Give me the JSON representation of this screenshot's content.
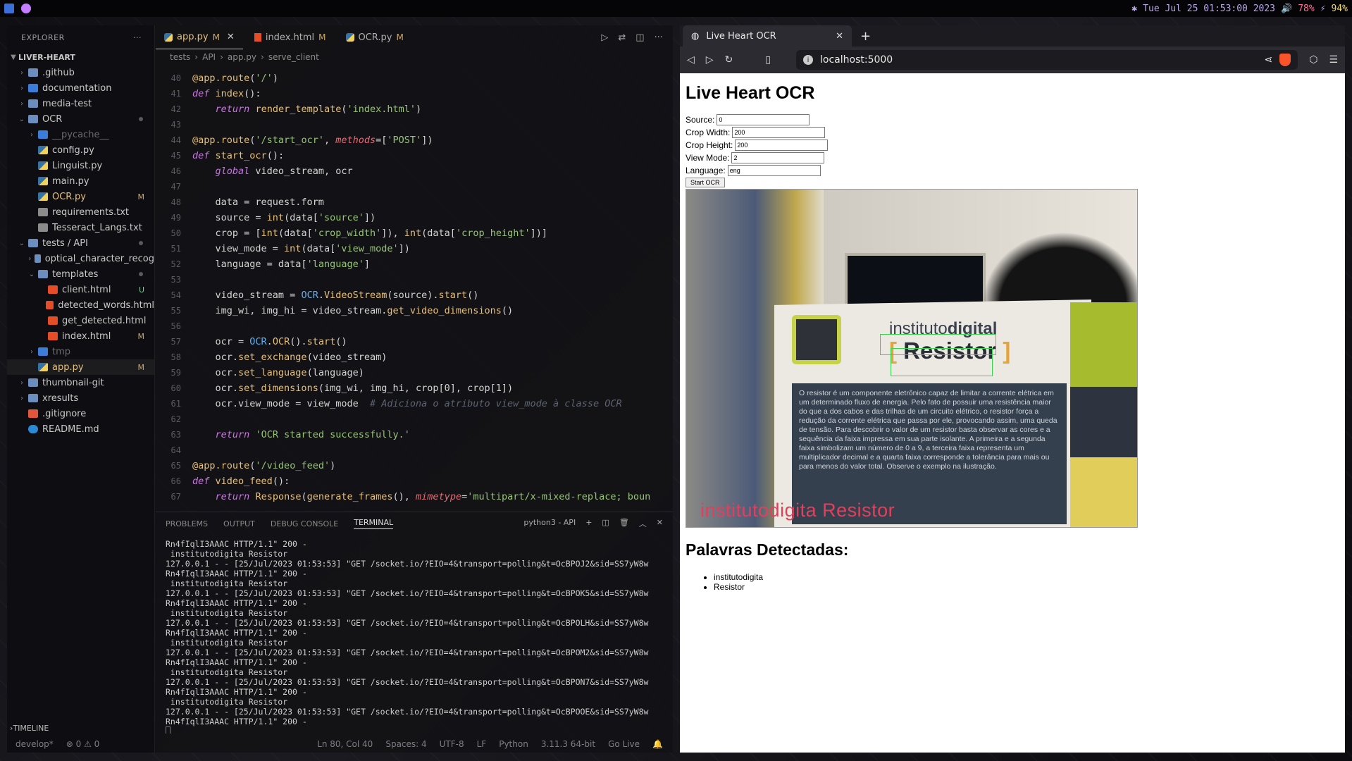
{
  "topbar": {
    "datetime": "Tue Jul 25 01:53:00 2023",
    "volume": "78%",
    "battery": "94%"
  },
  "vscode": {
    "explorer": {
      "title": "EXPLORER",
      "project": "LIVER-HEART",
      "items": [
        {
          "label": ".github",
          "type": "folder"
        },
        {
          "label": "documentation",
          "type": "folder"
        },
        {
          "label": "media-test",
          "type": "folder"
        },
        {
          "label": "OCR",
          "type": "folder"
        },
        {
          "label": "__pycache__",
          "type": "folder"
        },
        {
          "label": "config.py",
          "type": "py"
        },
        {
          "label": "Linguist.py",
          "type": "py"
        },
        {
          "label": "main.py",
          "type": "py"
        },
        {
          "label": "OCR.py",
          "type": "py",
          "badge": "M"
        },
        {
          "label": "requirements.txt",
          "type": "txt"
        },
        {
          "label": "Tesseract_Langs.txt",
          "type": "txt"
        },
        {
          "label": "tests / API",
          "type": "folder"
        },
        {
          "label": "optical_character_recog",
          "type": "folder"
        },
        {
          "label": "templates",
          "type": "folder"
        },
        {
          "label": "client.html",
          "type": "html",
          "badge": "U"
        },
        {
          "label": "detected_words.html",
          "type": "html"
        },
        {
          "label": "get_detected.html",
          "type": "html"
        },
        {
          "label": "index.html",
          "type": "html",
          "badge": "M"
        },
        {
          "label": "tmp",
          "type": "folder"
        },
        {
          "label": "app.py",
          "type": "py",
          "badge": "M"
        },
        {
          "label": "thumbnail-git",
          "type": "folder"
        },
        {
          "label": "xresults",
          "type": "folder"
        },
        {
          "label": ".gitignore",
          "type": "git"
        },
        {
          "label": "README.md",
          "type": "md"
        }
      ],
      "timeline": "TIMELINE"
    },
    "tabs": [
      {
        "label": "app.py",
        "badge": "M"
      },
      {
        "label": "index.html",
        "badge": "M"
      },
      {
        "label": "OCR.py",
        "badge": "M"
      }
    ],
    "breadcrumb": [
      "tests",
      "API",
      "app.py",
      "serve_client"
    ],
    "code_lines": [
      {
        "n": "40",
        "html": "<span class='dec'>@app.route</span>(<span class='str'>'/'</span>)"
      },
      {
        "n": "41",
        "html": "<span class='kw'>def</span> <span class='fn'>index</span>():"
      },
      {
        "n": "42",
        "html": "    <span class='kw'>return</span> <span class='fn'>render_template</span>(<span class='str'>'index.html'</span>)"
      },
      {
        "n": "43",
        "html": ""
      },
      {
        "n": "44",
        "html": "<span class='dec'>@app.route</span>(<span class='str'>'/start_ocr'</span>, <span class='param'>methods</span>=[<span class='str'>'POST'</span>])"
      },
      {
        "n": "45",
        "html": "<span class='kw'>def</span> <span class='fn'>start_ocr</span>():"
      },
      {
        "n": "46",
        "html": "    <span class='kw'>global</span> video_stream, ocr"
      },
      {
        "n": "47",
        "html": ""
      },
      {
        "n": "48",
        "html": "    data = request.form"
      },
      {
        "n": "49",
        "html": "    source = <span class='fn'>int</span>(data[<span class='str'>'source'</span>])"
      },
      {
        "n": "50",
        "html": "    crop = [<span class='fn'>int</span>(data[<span class='str'>'crop_width'</span>]), <span class='fn'>int</span>(data[<span class='str'>'crop_height'</span>])]"
      },
      {
        "n": "51",
        "html": "    view_mode = <span class='fn'>int</span>(data[<span class='str'>'view_mode'</span>])"
      },
      {
        "n": "52",
        "html": "    language = data[<span class='str'>'language'</span>]"
      },
      {
        "n": "53",
        "html": ""
      },
      {
        "n": "54",
        "html": "    video_stream = <span class='attr'>OCR</span>.<span class='fn'>VideoStream</span>(source).<span class='fn'>start</span>()"
      },
      {
        "n": "55",
        "html": "    img_wi, img_hi = video_stream.<span class='fn'>get_video_dimensions</span>()"
      },
      {
        "n": "56",
        "html": ""
      },
      {
        "n": "57",
        "html": "    ocr = <span class='attr'>OCR</span>.<span class='fn'>OCR</span>().<span class='fn'>start</span>()"
      },
      {
        "n": "58",
        "html": "    ocr.<span class='fn'>set_exchange</span>(video_stream)"
      },
      {
        "n": "59",
        "html": "    ocr.<span class='fn'>set_language</span>(language)"
      },
      {
        "n": "60",
        "html": "    ocr.<span class='fn'>set_dimensions</span>(img_wi, img_hi, crop[0], crop[1])"
      },
      {
        "n": "61",
        "html": "    ocr.view_mode = view_mode  <span class='cm'># Adiciona o atributo view_mode à classe OCR</span>"
      },
      {
        "n": "62",
        "html": ""
      },
      {
        "n": "63",
        "html": "    <span class='kw'>return</span> <span class='str'>'OCR started successfully.'</span>"
      },
      {
        "n": "64",
        "html": ""
      },
      {
        "n": "65",
        "html": "<span class='dec'>@app.route</span>(<span class='str'>'/video_feed'</span>)"
      },
      {
        "n": "66",
        "html": "<span class='kw'>def</span> <span class='fn'>video_feed</span>():"
      },
      {
        "n": "67",
        "html": "    <span class='kw'>return</span> <span class='fn'>Response</span>(<span class='fn'>generate_frames</span>(), <span class='param'>mimetype</span>=<span class='str'>'multipart/x-mixed-replace; boun</span>"
      }
    ],
    "panel_tabs": [
      "PROBLEMS",
      "OUTPUT",
      "DEBUG CONSOLE",
      "TERMINAL"
    ],
    "panel_right": "python3 - API",
    "terminal_lines": [
      "Rn4fIqlI3AAAC HTTP/1.1\" 200 -",
      " institutodigita Resistor",
      "127.0.0.1 - - [25/Jul/2023 01:53:53] \"GET /socket.io/?EIO=4&transport=polling&t=OcBPOJ2&sid=SS7yW8w",
      "Rn4fIqlI3AAAC HTTP/1.1\" 200 -",
      " institutodigita Resistor",
      "127.0.0.1 - - [25/Jul/2023 01:53:53] \"GET /socket.io/?EIO=4&transport=polling&t=OcBPOK5&sid=SS7yW8w",
      "Rn4fIqlI3AAAC HTTP/1.1\" 200 -",
      " institutodigita Resistor",
      "127.0.0.1 - - [25/Jul/2023 01:53:53] \"GET /socket.io/?EIO=4&transport=polling&t=OcBPOLH&sid=SS7yW8w",
      "Rn4fIqlI3AAAC HTTP/1.1\" 200 -",
      " institutodigita Resistor",
      "127.0.0.1 - - [25/Jul/2023 01:53:53] \"GET /socket.io/?EIO=4&transport=polling&t=OcBPOM2&sid=SS7yW8w",
      "Rn4fIqlI3AAAC HTTP/1.1\" 200 -",
      " institutodigita Resistor",
      "127.0.0.1 - - [25/Jul/2023 01:53:53] \"GET /socket.io/?EIO=4&transport=polling&t=OcBPON7&sid=SS7yW8w",
      "Rn4fIqlI3AAAC HTTP/1.1\" 200 -",
      " institutodigita Resistor",
      "127.0.0.1 - - [25/Jul/2023 01:53:53] \"GET /socket.io/?EIO=4&transport=polling&t=OcBPOOE&sid=SS7yW8w",
      "Rn4fIqlI3AAAC HTTP/1.1\" 200 -"
    ],
    "status": {
      "branch": "develop*",
      "problems": "⊗ 0 ⚠ 0",
      "position": "Ln 80, Col 40",
      "spaces": "Spaces: 4",
      "encoding": "UTF-8",
      "eol": "LF",
      "language": "Python",
      "version": "3.11.3 64-bit",
      "golive": "Go Live"
    }
  },
  "browser": {
    "tab_title": "Live Heart OCR",
    "url": "localhost:5000",
    "page": {
      "heading": "Live Heart OCR",
      "fields": [
        {
          "label": "Source:",
          "value": "0"
        },
        {
          "label": "Crop Width:",
          "value": "200"
        },
        {
          "label": "Crop Height:",
          "value": "200"
        },
        {
          "label": "View Mode:",
          "value": "2"
        },
        {
          "label": "Language:",
          "value": "eng"
        }
      ],
      "start_button": "Start OCR",
      "video": {
        "poster_line1_a": "instituto",
        "poster_line1_b": "digital",
        "poster_line2": "Resistor",
        "poster_text": "O resistor é um componente eletrônico capaz de limitar a corrente elétrica em um determinado fluxo de energia. Pelo fato de possuir uma resistência maior do que a dos cabos e das trilhas de um circuito elétrico, o resistor força a redução da corrente elétrica que passa por ele, provocando assim, uma queda de tensão. Para descobrir o valor de um resistor basta observar as cores e a sequência da faixa impressa em sua parte isolante. A primeira e a segunda faixa simbolizam um número de 0 a 9, a terceira faixa representa um multiplicador decimal e a quarta faixa corresponde a tolerância para mais ou para menos do valor total. Observe o exemplo na ilustração.",
        "ocr_overlay": "institutodigita Resistor"
      },
      "detected_heading": "Palavras Detectadas:",
      "detected_words": [
        "institutodigita",
        "Resistor"
      ]
    }
  }
}
